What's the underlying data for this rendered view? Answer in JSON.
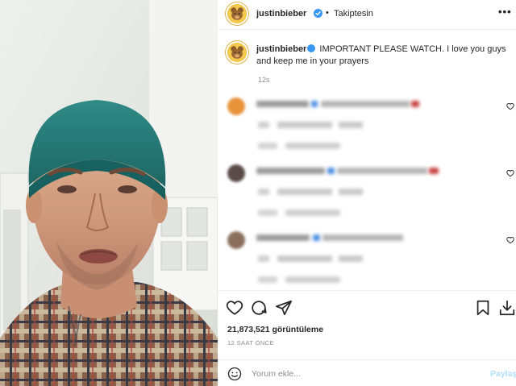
{
  "post": {
    "username": "justinbieber",
    "separator": "•",
    "follow_status": "Takiptesin",
    "more_label": "•••",
    "caption_user": "justinbieber",
    "caption_text": "IMPORTANT PLEASE WATCH. I love you guys and keep me in your prayers",
    "caption_time": "12s",
    "views": "21,873,521 görüntüleme",
    "posted_ago": "12 SAAT ÖNCE"
  },
  "comment_box": {
    "placeholder": "Yorum ekle...",
    "post_label": "Paylaş"
  },
  "icons": {
    "verified": "verified-badge-icon",
    "like": "heart-icon",
    "comment": "comment-icon",
    "share": "send-icon",
    "save": "bookmark-icon",
    "download": "download-icon",
    "emoji": "smiley-icon",
    "more": "more-options-icon"
  },
  "colors": {
    "verified_blue": "#3897f0",
    "text_primary": "#262626",
    "text_secondary": "#8e8e8e",
    "post_button": "#b2dffc"
  }
}
